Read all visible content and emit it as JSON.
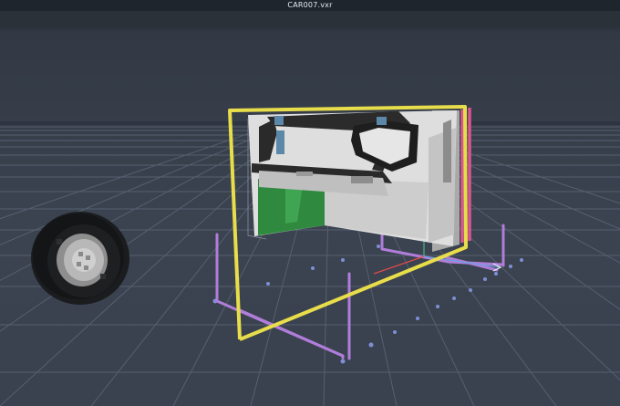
{
  "window": {
    "title": "CAR007.vxr"
  },
  "viewport": {
    "background": "#3a4250",
    "grid_color": "#5b6576",
    "highlight_colors": {
      "bounding_box_selected": "#e8dd4a",
      "bounding_box_secondary": "#d9578f",
      "handles": "#b07dd9",
      "guide_dots": "#7f8fd6"
    },
    "objects": [
      {
        "name": "wheel",
        "icon": "wheel-voxel"
      },
      {
        "name": "car-door",
        "icon": "door-voxel"
      }
    ]
  }
}
